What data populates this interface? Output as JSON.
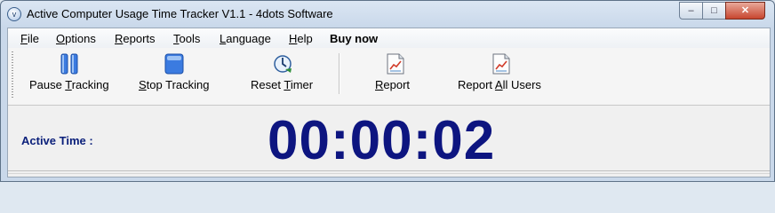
{
  "window": {
    "title": "Active Computer Usage Time Tracker V1.1 - 4dots Software",
    "controls": {
      "minimize": "–",
      "maximize": "□",
      "close": "✕"
    }
  },
  "menu": [
    {
      "pre": "",
      "u": "F",
      "post": "ile"
    },
    {
      "pre": "",
      "u": "O",
      "post": "ptions"
    },
    {
      "pre": "",
      "u": "R",
      "post": "eports"
    },
    {
      "pre": "",
      "u": "T",
      "post": "ools"
    },
    {
      "pre": "",
      "u": "L",
      "post": "anguage"
    },
    {
      "pre": "",
      "u": "H",
      "post": "elp"
    }
  ],
  "menu_buy_now": "Buy now",
  "toolbar": {
    "pause": {
      "pre": "Pause ",
      "u": "T",
      "post": "racking"
    },
    "stop": {
      "pre": "",
      "u": "S",
      "post": "top Tracking"
    },
    "reset": {
      "pre": "Reset ",
      "u": "T",
      "post": "imer"
    },
    "report": {
      "pre": "",
      "u": "R",
      "post": "eport"
    },
    "report_all": {
      "pre": "Report ",
      "u": "A",
      "post": "ll Users"
    }
  },
  "main": {
    "active_time_label": "Active Time :",
    "timer": "00:00:02"
  },
  "colors": {
    "accent": "#0d1580",
    "label": "#0a1f7a"
  },
  "icons": {
    "pause": "pause-icon",
    "stop": "stop-icon",
    "reset": "reset-timer-icon",
    "report": "report-icon",
    "report_all": "report-all-icon"
  }
}
